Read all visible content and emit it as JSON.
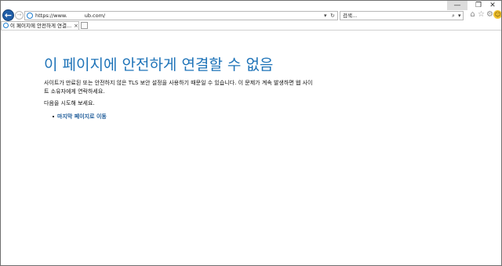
{
  "browser": {
    "url_scheme": "https://www.",
    "url_host": "ub.com/",
    "search_placeholder": "검색...",
    "tab_title": "이 페이지에 안전하게 연결...",
    "tab_close": "×",
    "window_controls": {
      "minimize": "—",
      "maximize": "❐",
      "close": "✕"
    },
    "icons": {
      "back": "←",
      "forward": "→",
      "address_dropdown": "▾",
      "refresh": "↻",
      "search": "⌕",
      "search_dropdown": "▾",
      "home": "⌂",
      "favorites": "☆",
      "settings": "⚙",
      "feedback": "☺"
    }
  },
  "page": {
    "heading": "이 페이지에 안전하게 연결할 수 없음",
    "description": "사이트가 만료된 또는 안전하지 않은 TLS 보안 설정을 사용하기 때문일 수 있습니다. 이 문제가 계속 발생하면 웹 사이트 소유자에게 연락하세요.",
    "try_label": "다음을 시도해 보세요.",
    "suggestions": [
      {
        "label": "마지막 페이지로 이동"
      }
    ],
    "colors": {
      "heading": "#1e73b8",
      "link": "#1e5b99"
    }
  }
}
